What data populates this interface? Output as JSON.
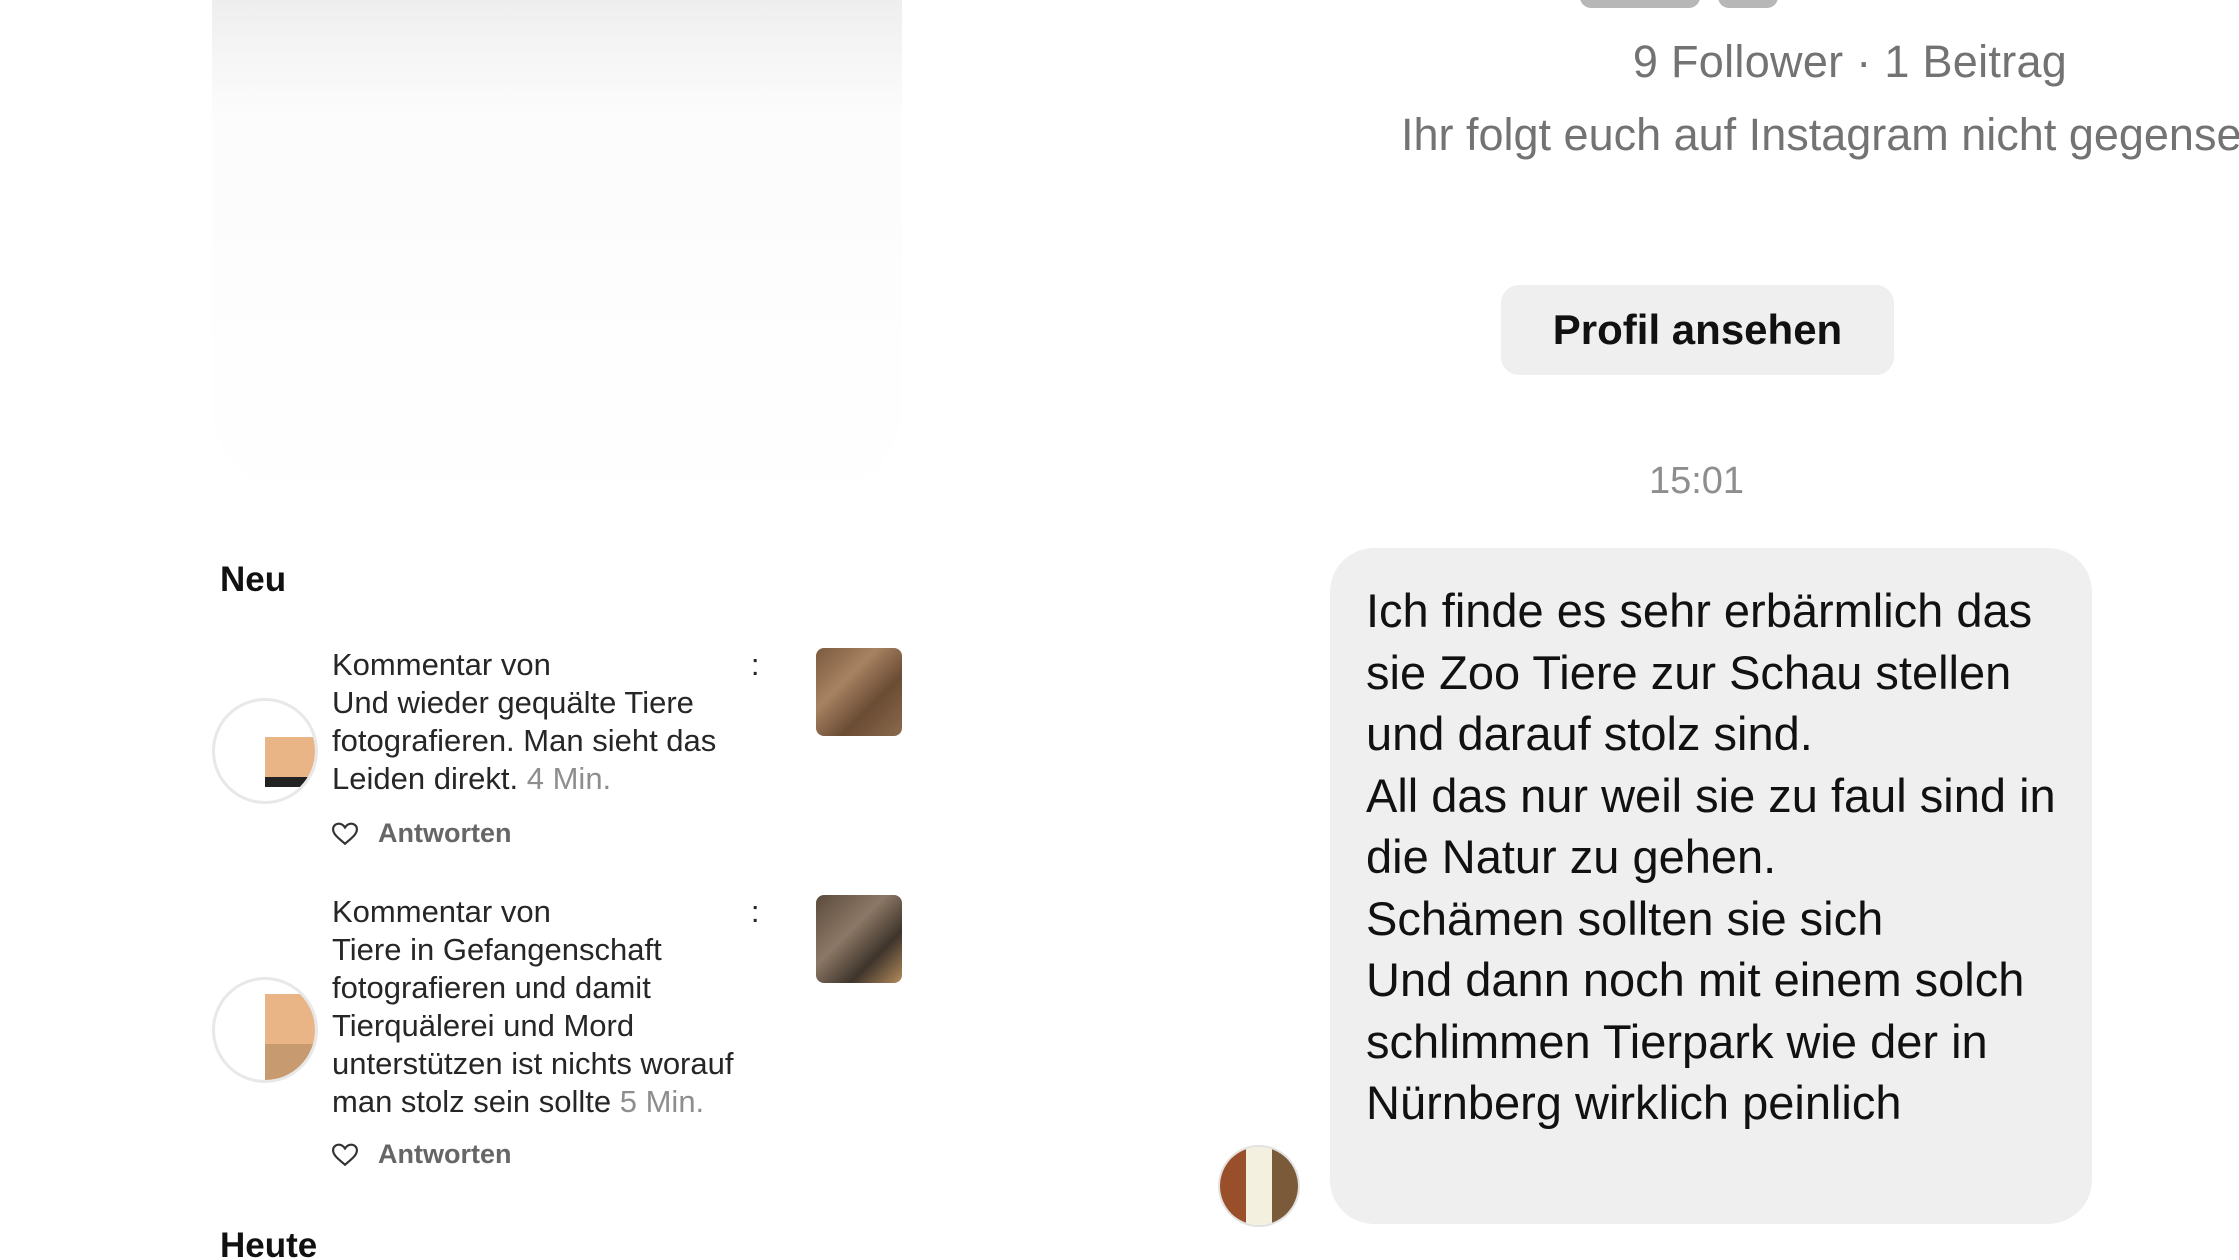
{
  "notifications": {
    "section_new": "Neu",
    "section_today": "Heute",
    "items": [
      {
        "prefix": "Kommentar von",
        "comment_end": ":",
        "text": "Und wieder gequälte Tiere fotografieren. Man sieht das Leiden direkt.",
        "time": "4 Min.",
        "reply_label": "Antworten"
      },
      {
        "prefix": "Kommentar von",
        "comment_end": ":",
        "text": "Tiere in Gefangenschaft fotografieren und damit Tierquälerei und Mord unterstützen ist nichts worauf man stolz sein sollte",
        "time": "5 Min.",
        "reply_label": "Antworten"
      }
    ]
  },
  "dm": {
    "profile_stats": "9 Follower · 1 Beitrag",
    "mutual_text": "Ihr folgt euch auf Instagram nicht gegenseitig",
    "view_profile_label": "Profil ansehen",
    "timestamp": "15:01",
    "message": "Ich finde es sehr erbärmlich das sie Zoo Tiere zur Schau stellen und darauf stolz sind.\nAll das nur weil sie zu faul sind in die Natur zu gehen.\nSchämen sollten sie sich\nUnd dann noch mit einem solch schlimmen Tierpark wie der in Nürnberg wirklich peinlich"
  },
  "icons": {
    "heart": "heart-outline-icon"
  }
}
